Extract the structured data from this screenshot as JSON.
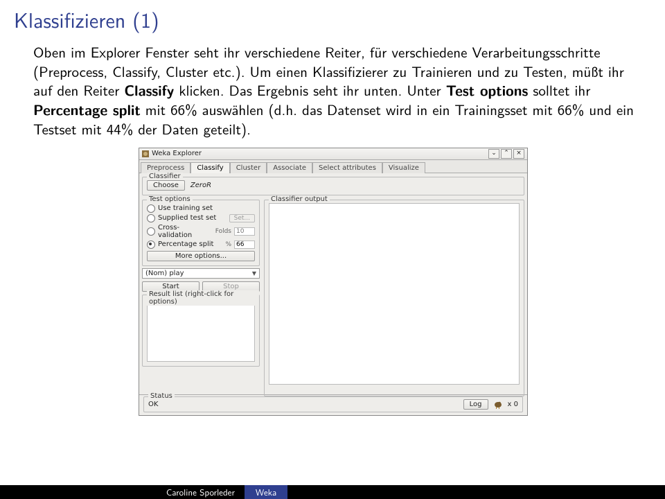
{
  "slide": {
    "title": "Klassifizieren (1)",
    "body": "Oben im Explorer Fenster seht ihr verschiedene Reiter, für verschiedene Verarbeitungsschritte (Preprocess, Classify, Cluster etc.). Um einen Klassifizierer zu Trainieren und zu Testen, müßt ihr auf den Reiter ",
    "bold1": "Classify",
    "body2": " klicken. Das Ergebnis seht ihr unten. Unter ",
    "bold2": "Test options",
    "body3": " solltet ihr ",
    "bold3": "Percentage split",
    "body4": " mit 66% auswählen (d.h. das Datenset wird in ein Trainingsset mit 66% und ein Testset mit 44% der Daten geteilt)."
  },
  "weka": {
    "title": "Weka Explorer",
    "tabs": [
      "Preprocess",
      "Classify",
      "Cluster",
      "Associate",
      "Select attributes",
      "Visualize"
    ],
    "active_tab": 1,
    "classifier_group": "Classifier",
    "choose_btn": "Choose",
    "classifier_name": "ZeroR",
    "test_options_label": "Test options",
    "classifier_output_label": "Classifier output",
    "opt_training": "Use training set",
    "opt_supplied": "Supplied test set",
    "set_btn": "Set...",
    "opt_cv": "Cross-validation",
    "folds_label": "Folds",
    "folds_value": "10",
    "opt_pct": "Percentage split",
    "pct_label": "%",
    "pct_value": "66",
    "more_options": "More options...",
    "attr_select": "(Nom) play",
    "start_btn": "Start",
    "stop_btn": "Stop",
    "result_list_label": "Result list (right-click for options)",
    "status_label": "Status",
    "status_value": "OK",
    "log_btn": "Log",
    "bird_count": "x 0",
    "win_min": "⌄",
    "win_max": "⌃",
    "win_close": "×"
  },
  "footer": {
    "author": "Caroline Sporleder",
    "title": "Weka"
  }
}
